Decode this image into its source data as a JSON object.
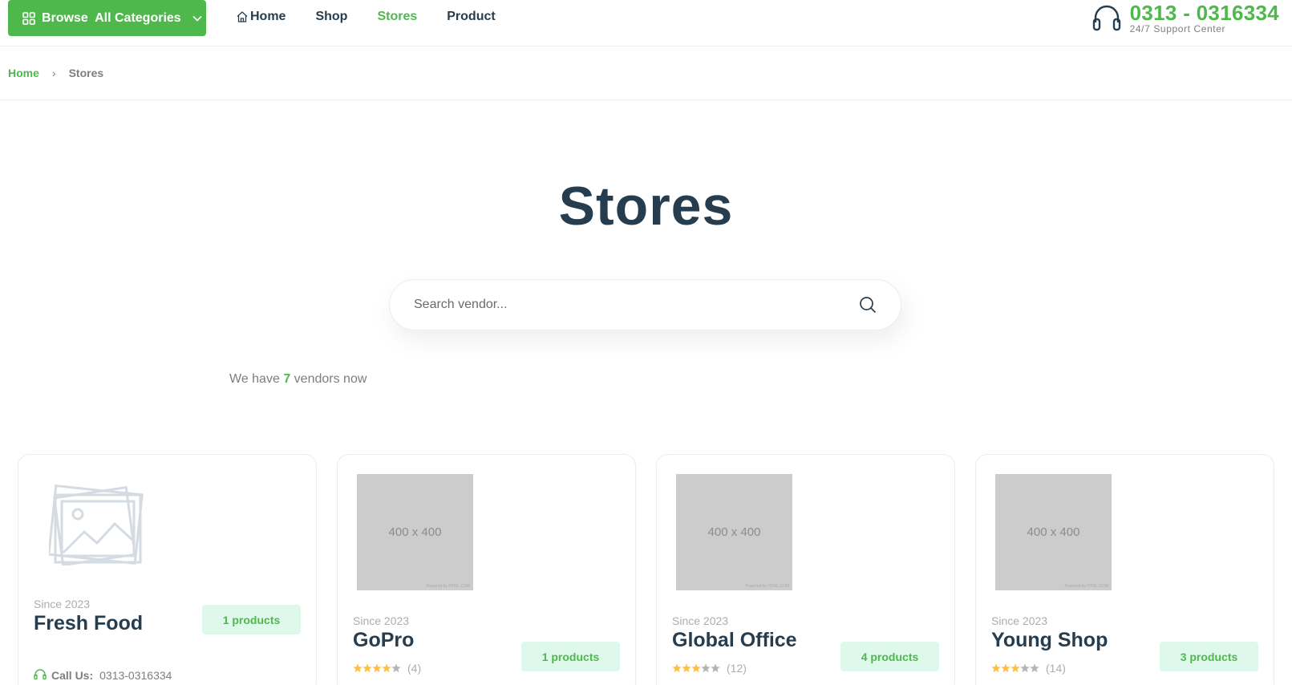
{
  "header": {
    "browse_label": "Browse  All Categories",
    "nav": [
      {
        "label": "Home"
      },
      {
        "label": "Shop"
      },
      {
        "label": "Stores"
      },
      {
        "label": "Product"
      }
    ],
    "support_phone": "0313 - 0316334",
    "support_sub": "24/7 Support Center"
  },
  "breadcrumb": {
    "home": "Home",
    "separator": "›",
    "current": "Stores"
  },
  "main": {
    "title": "Stores",
    "search_placeholder": "Search vendor...",
    "count_prefix": "We have",
    "count_value": "7",
    "count_suffix": "vendors now"
  },
  "stores": [
    {
      "name": "Fresh Food",
      "since": "Since 2023",
      "products": "1 products",
      "image": "placeholder-icon",
      "call_label": "Call Us:",
      "phone": "0313-0316334"
    },
    {
      "name": "GoPro",
      "since": "Since 2023",
      "products": "1 products",
      "image": "400 x 400",
      "image_credit": "Powered by HTML.COM",
      "rating_count": "(4)",
      "stars": 4
    },
    {
      "name": "Global Office",
      "since": "Since 2023",
      "products": "4 products",
      "image": "400 x 400",
      "image_credit": "Powered by HTML.COM",
      "rating_count": "(12)",
      "stars": 3
    },
    {
      "name": "Young Shop",
      "since": "Since 2023",
      "products": "3 products",
      "image": "400 x 400",
      "image_credit": "Powered by HTML.COM",
      "rating_count": "(14)",
      "stars": 3
    }
  ],
  "colors": {
    "brand": "#4fb84c",
    "text_dark": "#253d4e",
    "badge_bg": "#def9ec",
    "star": "#fdc040"
  },
  "icons": [
    "grid-icon",
    "chevron-down-icon",
    "home-icon",
    "headset-icon",
    "search-icon",
    "image-placeholder-icon",
    "star-icon"
  ]
}
